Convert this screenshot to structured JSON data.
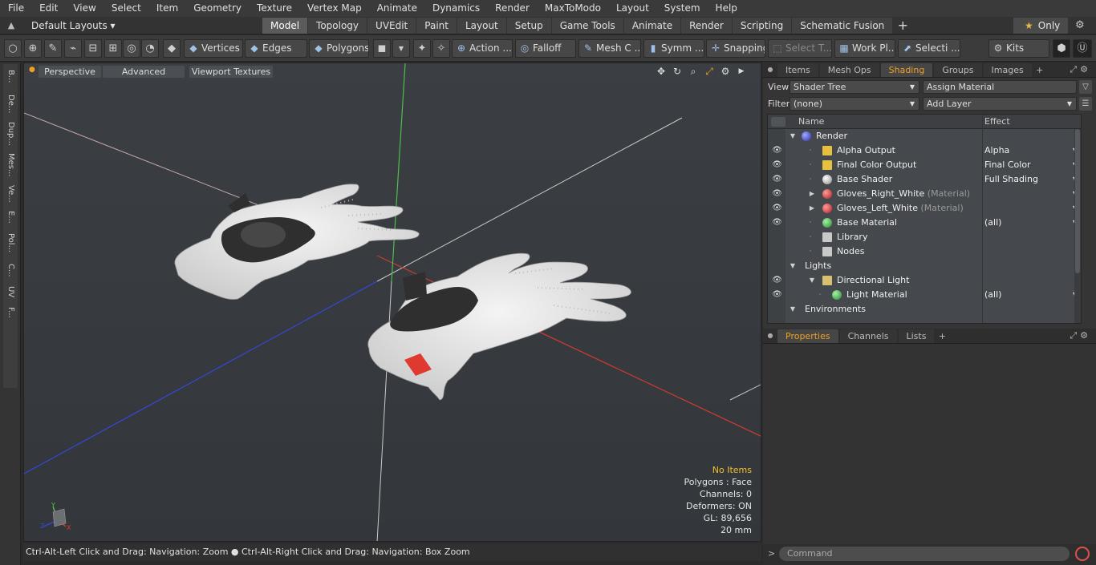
{
  "menu": [
    "File",
    "Edit",
    "View",
    "Select",
    "Item",
    "Geometry",
    "Texture",
    "Vertex Map",
    "Animate",
    "Dynamics",
    "Render",
    "MaxToModo",
    "Layout",
    "System",
    "Help"
  ],
  "layoutbar": {
    "layouts_label": "Default Layouts ▾",
    "tabs": [
      "Model",
      "Topology",
      "UVEdit",
      "Paint",
      "Layout",
      "Setup",
      "Game Tools",
      "Animate",
      "Render",
      "Scripting",
      "Schematic Fusion"
    ],
    "active_tab": "Model",
    "only_label": "Only"
  },
  "toolbar": {
    "vertices": "Vertices",
    "edges": "Edges",
    "polygons": "Polygons",
    "action": "Action ...",
    "falloff": "Falloff",
    "mesh": "Mesh C ...",
    "symm": "Symm ...",
    "snapping": "Snapping",
    "select_t": "Select T...",
    "work_pl": "Work Pl...",
    "selecti": "Selecti ...",
    "kits": "Kits"
  },
  "left_tabs": [
    "B...",
    "De...",
    "Dup...",
    "Mes...",
    "Ve...",
    "E...",
    "Pol...",
    "C...",
    "UV",
    "F..."
  ],
  "viewport": {
    "perspective": "Perspective",
    "advanced": "Advanced",
    "viewport_textures": "Viewport Textures",
    "stats": {
      "items": "No Items",
      "polygons": "Polygons : Face",
      "channels": "Channels: 0",
      "deformers": "Deformers: ON",
      "gl": "GL: 89,656",
      "scale": "20 mm"
    },
    "axes": {
      "x": "X",
      "y": "Y",
      "z": "Z"
    }
  },
  "statusbar": "Ctrl-Alt-Left Click and Drag: Navigation: Zoom ● Ctrl-Alt-Right Click and Drag: Navigation: Box Zoom",
  "panel_tabs": [
    "Items",
    "Mesh Ops",
    "Shading",
    "Groups",
    "Images"
  ],
  "panel_active_tab": "Shading",
  "view_label": "View",
  "view_value": "Shader Tree",
  "assign_material": "Assign Material",
  "filter_label": "Filter",
  "filter_value": "(none)",
  "add_layer": "Add Layer",
  "tree": {
    "col_name": "Name",
    "col_effect": "Effect",
    "rows": [
      {
        "label": "Render",
        "sub": "",
        "effect": "",
        "eye": false,
        "exp": "▼",
        "depth": 0,
        "icon": "sphere-blue"
      },
      {
        "label": "Alpha Output",
        "sub": "",
        "effect": "Alpha",
        "eye": true,
        "exp": "",
        "depth": 1,
        "icon": "output"
      },
      {
        "label": "Final Color Output",
        "sub": "",
        "effect": "Final Color",
        "eye": true,
        "exp": "",
        "depth": 1,
        "icon": "output"
      },
      {
        "label": "Base Shader",
        "sub": "",
        "effect": "Full Shading",
        "eye": true,
        "exp": "",
        "depth": 1,
        "icon": "sphere-grey"
      },
      {
        "label": "Gloves_Right_White",
        "sub": " (Material)",
        "effect": "",
        "eye": true,
        "exp": "▶",
        "depth": 1,
        "icon": "sphere-red"
      },
      {
        "label": "Gloves_Left_White",
        "sub": " (Material)",
        "effect": "",
        "eye": true,
        "exp": "▶",
        "depth": 1,
        "icon": "sphere-red"
      },
      {
        "label": "Base Material",
        "sub": "",
        "effect": "(all)",
        "eye": true,
        "exp": "",
        "depth": 1,
        "icon": "sphere-green"
      },
      {
        "label": "Library",
        "sub": "",
        "effect": "",
        "eye": false,
        "exp": "",
        "depth": 1,
        "icon": "folder"
      },
      {
        "label": "Nodes",
        "sub": "",
        "effect": "",
        "eye": false,
        "exp": "",
        "depth": 1,
        "icon": "folder"
      },
      {
        "label": "Lights",
        "sub": "",
        "effect": "",
        "eye": false,
        "exp": "▼",
        "depth": 0,
        "icon": ""
      },
      {
        "label": "Directional Light",
        "sub": "",
        "effect": "",
        "eye": true,
        "exp": "▼",
        "depth": 1,
        "icon": "light"
      },
      {
        "label": "Light Material",
        "sub": "",
        "effect": "(all)",
        "eye": true,
        "exp": "",
        "depth": 2,
        "icon": "sphere-green"
      },
      {
        "label": "Environments",
        "sub": "",
        "effect": "",
        "eye": false,
        "exp": "▼",
        "depth": 0,
        "icon": ""
      }
    ]
  },
  "props_tabs": [
    "Properties",
    "Channels",
    "Lists"
  ],
  "props_active_tab": "Properties",
  "command_placeholder": "Command",
  "colors": {
    "accent": "#f0a020",
    "viewport_bg": "#3a3e42",
    "x_axis": "#d23a2e",
    "y_axis": "#4ec04a",
    "z_axis": "#2e3ed0"
  }
}
